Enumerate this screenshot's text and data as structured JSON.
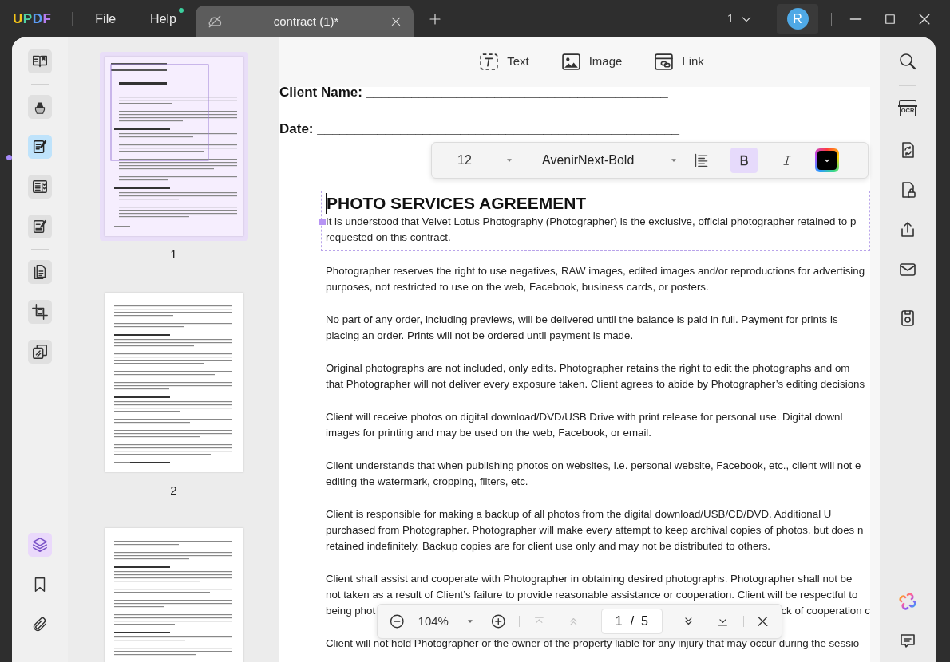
{
  "app": {
    "logo": "UPDF",
    "menus": [
      {
        "label": "File",
        "badge": false
      },
      {
        "label": "Help",
        "badge": true
      }
    ]
  },
  "tabs": [
    {
      "title": "contract (1)*",
      "selected": true
    }
  ],
  "title_bar": {
    "page_count": "1",
    "avatar": "R"
  },
  "left_tool_groups": [
    [
      {
        "kind": "reader",
        "selected": false
      }
    ],
    [
      {
        "kind": "comment",
        "selected": false
      },
      {
        "kind": "edit",
        "selected": true
      },
      {
        "kind": "form",
        "selected": false
      },
      {
        "kind": "redact",
        "selected": false
      }
    ],
    [
      {
        "kind": "pages",
        "selected": false
      },
      {
        "kind": "crop",
        "selected": false
      },
      {
        "kind": "duplicate",
        "selected": false
      }
    ]
  ],
  "left_bottom_tools": [
    {
      "kind": "layers",
      "selected": true
    },
    {
      "kind": "bookmark",
      "selected": false
    },
    {
      "kind": "attachment",
      "selected": false
    }
  ],
  "thumbnails": [
    {
      "label": "1",
      "selected": true
    },
    {
      "label": "2",
      "selected": false
    },
    {
      "selected": false
    }
  ],
  "edit_toolbar": [
    {
      "kind": "text",
      "label": "Text"
    },
    {
      "kind": "image",
      "label": "Image"
    },
    {
      "kind": "link",
      "label": "Link"
    }
  ],
  "format_toolbar": {
    "font_size": "12",
    "font": "AvenirNext-Bold",
    "bold": true,
    "italic": false,
    "color": "#000000"
  },
  "document": {
    "fields": [
      {
        "label": "Client Name: ________________________________________"
      },
      {
        "label": "Date: ________________________________________________"
      }
    ],
    "heading": "PHOTO SERVICES AGREEMENT",
    "intro": [
      "It is understood that Velvet Lotus Photography (Photographer) is the exclusive, official photographer retained to p",
      "requested on this contract."
    ],
    "paragraphs": [
      {
        "lines": [
          "Photographer reserves the right to use negatives, RAW images, edited images and/or reproductions for advertising",
          "purposes, not restricted to use on the web, Facebook, business cards, or posters."
        ]
      },
      {
        "lines": [
          "No part of any order, including previews, will be delivered until the balance is paid in full. Payment for prints is",
          "placing an order. Prints will not be ordered until payment is made."
        ]
      },
      {
        "lines": [
          "Original photographs are not included, only edits. Photographer retains the right to edit the photographs and om",
          "that Photographer will not deliver every exposure taken. Client agrees to abide by Photographer’s editing decisions"
        ]
      },
      {
        "lines": [
          "Client will receive photos on digital download/DVD/USB Drive with print release for personal use. Digital downl",
          "images for printing and may be used on the web, Facebook, or email."
        ]
      },
      {
        "lines": [
          "Client understands that when publishing photos on websites, i.e. personal website, Facebook, etc., client will not e",
          "editing the watermark, cropping, filters, etc."
        ]
      },
      {
        "lines": [
          "Client is responsible for making a backup of all photos from the digital download/USB/CD/DVD. Additional U",
          "purchased from Photographer. Photographer will make every attempt to keep archival copies of photos, but does n",
          "retained indefinitely. Backup copies are for client use only and may not be distributed to others."
        ]
      },
      {
        "lines": [
          "Client shall assist and cooperate with Photographer in obtaining desired photographs. Photographer shall not be",
          "not taken as a result of Client’s failure to provide reasonable assistance or cooperation. Client will be respectful to"
        ],
        "covered_line": {
          "left": "being phot",
          "right": "ck of cooperation c"
        }
      },
      {
        "lines": [
          "Client will not hold Photographer or the owner of the property liable for any injury that may occur during the sessio"
        ]
      }
    ]
  },
  "zoom_bar": {
    "zoom": "104%",
    "page": "1",
    "total": "/  5"
  },
  "right_tool_groups": [
    [
      {
        "kind": "search"
      }
    ],
    [
      {
        "kind": "ocr",
        "label": "OCR"
      },
      {
        "kind": "convert"
      },
      {
        "kind": "protect"
      },
      {
        "kind": "share"
      },
      {
        "kind": "email"
      }
    ],
    [
      {
        "kind": "save"
      }
    ]
  ],
  "right_bottom_tools": [
    {
      "kind": "ai"
    },
    {
      "kind": "comment"
    }
  ]
}
